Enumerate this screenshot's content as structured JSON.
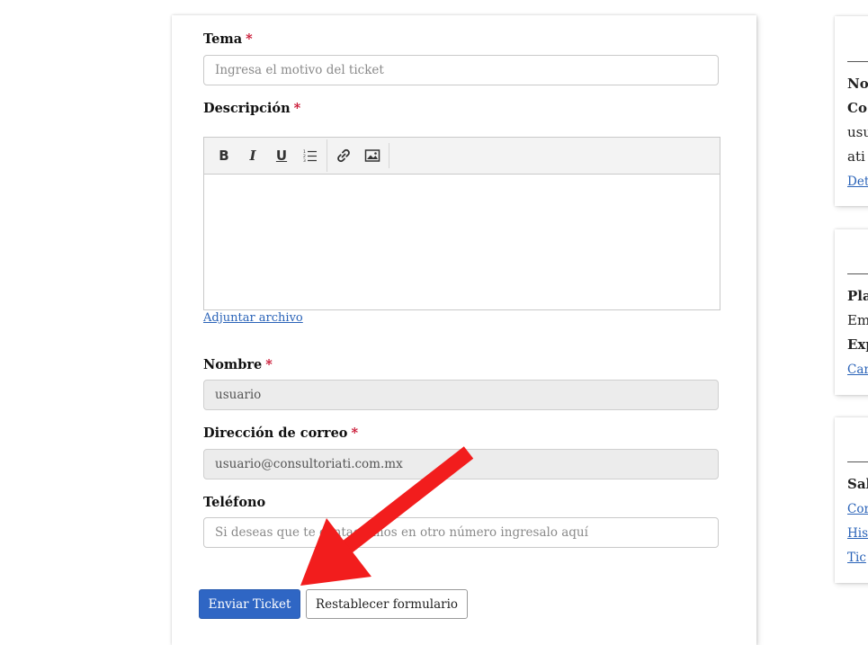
{
  "form": {
    "subject": {
      "label": "Tema",
      "required": "*",
      "placeholder": "Ingresa el motivo del ticket"
    },
    "description": {
      "label": "Descripción",
      "required": "*",
      "attach_link": "Adjuntar archivo"
    },
    "toolbar": {
      "bold": "B",
      "italic": "I",
      "underline": "U"
    },
    "name": {
      "label": "Nombre",
      "required": "*",
      "value": "usuario"
    },
    "email": {
      "label": "Dirección de correo",
      "required": "*",
      "value": "usuario@consultoriati.com.mx"
    },
    "phone": {
      "label": "Teléfono",
      "placeholder": "Si deseas que te contactemos en otro número ingresalo aquí"
    },
    "submit_label": "Enviar Ticket",
    "reset_label": "Restablecer formulario"
  },
  "sidebar": {
    "card1": {
      "line1": "No",
      "line2": "Co",
      "line3": "usu",
      "line4": "ati",
      "link": "Det"
    },
    "card2": {
      "line1": "Pla",
      "line2": "Em",
      "line3": "Exp",
      "link": "Car"
    },
    "card3": {
      "line1": "Sal",
      "link1": "Cor",
      "link2": "His",
      "link3": "Tic"
    }
  },
  "colors": {
    "primary": "#2f66c4",
    "required": "#c8102e",
    "link": "#2a63b8",
    "annotation_arrow": "#f21d1d"
  }
}
